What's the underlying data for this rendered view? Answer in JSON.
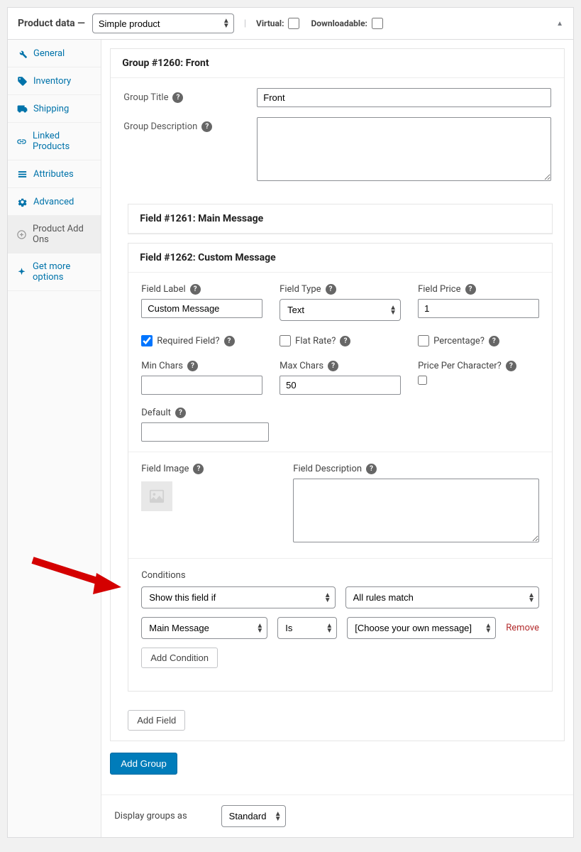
{
  "header": {
    "title": "Product data —",
    "product_type": "Simple product",
    "virtual_label": "Virtual:",
    "downloadable_label": "Downloadable:"
  },
  "sidebar": {
    "items": [
      {
        "label": "General"
      },
      {
        "label": "Inventory"
      },
      {
        "label": "Shipping"
      },
      {
        "label": "Linked Products"
      },
      {
        "label": "Attributes"
      },
      {
        "label": "Advanced"
      },
      {
        "label": "Product Add Ons"
      },
      {
        "label": "Get more options"
      }
    ]
  },
  "group": {
    "header": "Group #1260: Front",
    "title_label": "Group Title",
    "title_value": "Front",
    "desc_label": "Group Description",
    "desc_value": ""
  },
  "field1": {
    "header": "Field #1261: Main Message"
  },
  "field2": {
    "header": "Field #1262: Custom Message",
    "labels": {
      "field_label": "Field Label",
      "field_type": "Field Type",
      "field_price": "Field Price",
      "required": "Required Field?",
      "flat_rate": "Flat Rate?",
      "percentage": "Percentage?",
      "min_chars": "Min Chars",
      "max_chars": "Max Chars",
      "price_per_char": "Price Per Character?",
      "default": "Default",
      "field_image": "Field Image",
      "field_description": "Field Description",
      "conditions": "Conditions"
    },
    "values": {
      "field_label": "Custom Message",
      "field_type": "Text",
      "field_price": "1",
      "required": true,
      "flat_rate": false,
      "percentage": false,
      "min_chars": "",
      "max_chars": "50",
      "price_per_char": false,
      "default": "",
      "field_description": ""
    },
    "conditions": {
      "action": "Show this field if",
      "match": "All rules match",
      "rule_field": "Main Message",
      "rule_op": "Is",
      "rule_value": "[Choose your own message]",
      "remove": "Remove",
      "add_condition": "Add Condition"
    }
  },
  "buttons": {
    "add_field": "Add Field",
    "add_group": "Add Group"
  },
  "footer": {
    "display_label": "Display groups as",
    "display_value": "Standard"
  }
}
